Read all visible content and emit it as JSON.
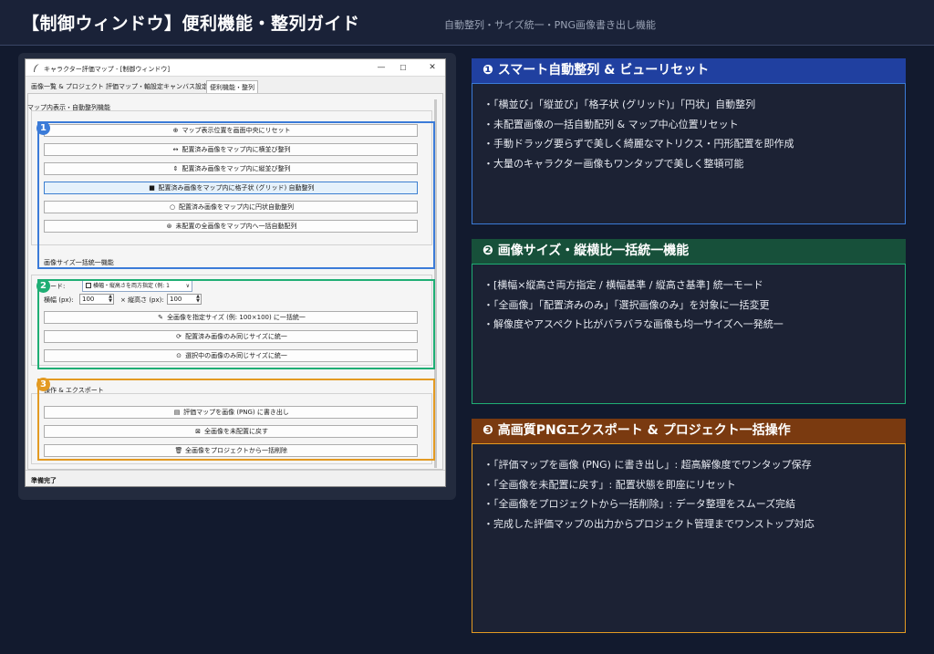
{
  "header": {
    "title": "【制御ウィンドウ】便利機能・整列ガイド",
    "subtitle": "自動整列・サイズ統一・PNG画像書き出し機能"
  },
  "window": {
    "title": "キャラクター評価マップ - [制御ウィンドウ]",
    "controls": {
      "minimize": "—",
      "maximize": "☐",
      "close": "✕"
    },
    "tabs": [
      {
        "label": "画像一覧 & プロジェクト"
      },
      {
        "label": "評価マップ・軸設定"
      },
      {
        "label": "キャンバス設定"
      },
      {
        "label": "便利機能・整列"
      }
    ],
    "align_section": {
      "label": "マップ内表示・自動整列機能",
      "buttons": [
        {
          "icon": "⊕",
          "label": "マップ表示位置を画面中央にリセット"
        },
        {
          "icon": "↔",
          "label": "配置済み画像をマップ内に横並び整列"
        },
        {
          "icon": "⇕",
          "label": "配置済み画像をマップ内に縦並び整列"
        },
        {
          "icon": "■",
          "label": "配置済み画像をマップ内に格子状 (グリッド) 自動整列"
        },
        {
          "icon": "○",
          "label": "配置済み画像をマップ内に円状自動整列"
        },
        {
          "icon": "⊛",
          "label": "未配置の全画像をマップ内へ一括自動配列"
        }
      ]
    },
    "size_section": {
      "label": "画像サイズ一括統一機能",
      "mode_label": "モード:",
      "mode_value": "横幅・縦高さを両方指定 (例: 1",
      "width_label": "横幅 (px):",
      "width_value": "100",
      "height_label": "× 縦高さ (px):",
      "height_value": "100",
      "buttons": [
        {
          "icon": "✎",
          "label": "全画像を指定サイズ (例: 100×100) に一括統一"
        },
        {
          "icon": "⟳",
          "label": "配置済み画像のみ同じサイズに統一"
        },
        {
          "icon": "⊙",
          "label": "選択中の画像のみ同じサイズに統一"
        }
      ]
    },
    "export_section": {
      "label": "操作 & エクスポート",
      "buttons": [
        {
          "icon": "▤",
          "label": "評価マップを画像 (PNG) に書き出し"
        },
        {
          "icon": "⊠",
          "label": "全画像を未配置に戻す"
        },
        {
          "icon": "🗑",
          "label": "全画像をプロジェクトから一括削除"
        }
      ]
    },
    "status": "準備完了"
  },
  "badges": [
    "1",
    "2",
    "3"
  ],
  "colors": {
    "blue": "#3b7bd8",
    "green": "#1fae74",
    "orange": "#e39a22",
    "panel1_head": "#2040a0",
    "panel2_head": "#17503a",
    "panel3_head": "#7a3a10"
  },
  "panels": [
    {
      "title": "❶ スマート自動整列 & ビューリセット",
      "items": [
        "・「横並び」「縦並び」「格子状 (グリッド)」「円状」自動整列",
        "・未配置画像の一括自動配列 & マップ中心位置リセット",
        "・手動ドラッグ要らずで美しく綺麗なマトリクス・円形配置を即作成",
        "・大量のキャラクター画像もワンタップで美しく整頓可能"
      ]
    },
    {
      "title": "❷ 画像サイズ・縦横比一括統一機能",
      "items": [
        "・[横幅×縦高さ両方指定 / 横幅基準 / 縦高さ基準] 統一モード",
        "・「全画像」「配置済みのみ」「選択画像のみ」を対象に一括変更",
        "・解像度やアスペクト比がバラバラな画像も均一サイズへ一発統一"
      ]
    },
    {
      "title": "❸ 高画質PNGエクスポート & プロジェクト一括操作",
      "items": [
        "・「評価マップを画像 (PNG) に書き出し」: 超高解像度でワンタップ保存",
        "・「全画像を未配置に戻す」: 配置状態を即座にリセット",
        "・「全画像をプロジェクトから一括削除」: データ整理をスムーズ完結",
        "・完成した評価マップの出力からプロジェクト管理までワンストップ対応"
      ]
    }
  ]
}
